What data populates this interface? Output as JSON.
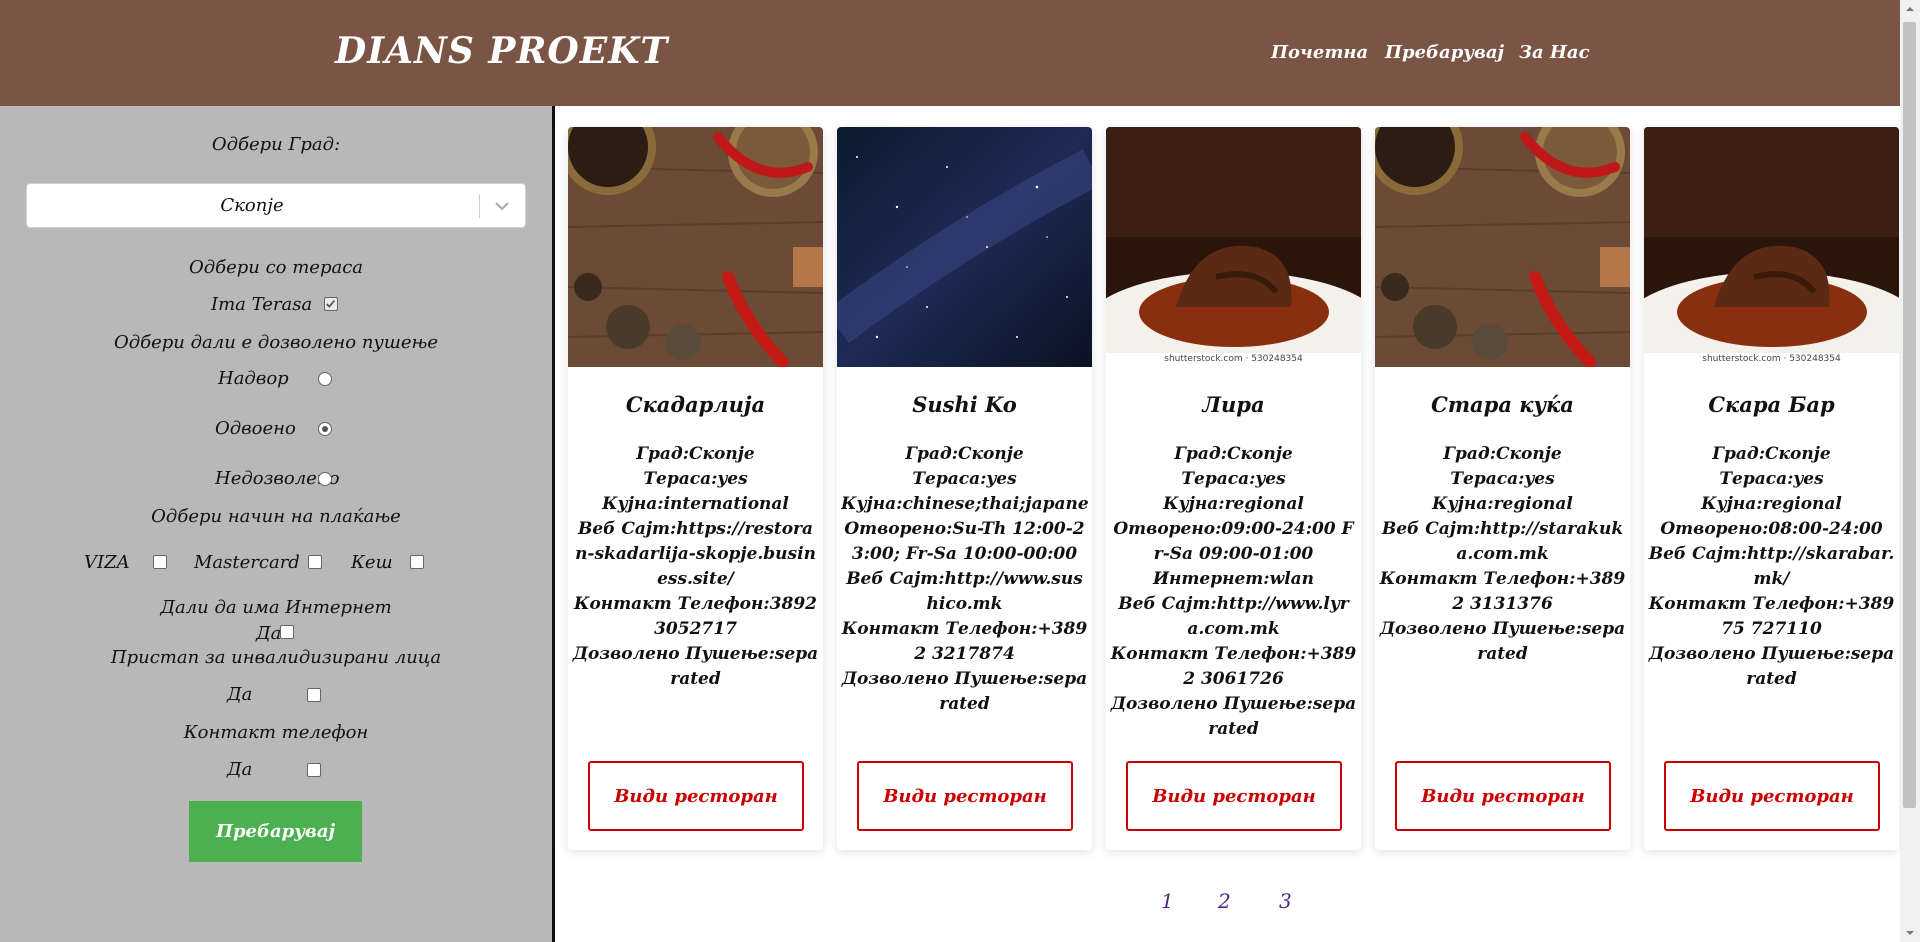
{
  "header": {
    "brand": "DIANS PROEKT",
    "nav": [
      "Почетна",
      "Пребарувај",
      "За Нас"
    ]
  },
  "filters": {
    "city_label": "Одбери Град:",
    "city_value": "Скопје",
    "terrace_label": "Одбери со тераса",
    "terrace_option": "Ima Terasa",
    "smoking_label": "Одбери дали е дозволено пушење",
    "smoking_options": [
      "Надвор",
      "Одвоено",
      "Недозволено"
    ],
    "payment_label": "Одбери начин на плаќање",
    "payment_options": [
      "VIZA",
      "Mastercard",
      "Кеш"
    ],
    "internet_label": "Дали да има Интернет",
    "internet_option": "Да",
    "accessibility_label": "Пристап за инвалидизирани лица",
    "accessibility_option": "Да",
    "phone_label": "Контакт телефон",
    "phone_option": "Да",
    "search_button": "Пребарувај"
  },
  "restaurants": [
    {
      "name": "Скадарлија",
      "info": [
        "Град:Скопје",
        "Тераса:yes",
        "Кујна:international",
        "Веб Сајт:https://restoran-skadarlija-skopje.business.site/",
        "Контакт Телефон:38923052717",
        "Дозволено Пушење:separated"
      ],
      "button": "Види ресторан"
    },
    {
      "name": "Sushi Ko",
      "info": [
        "Град:Скопје",
        "Тераса:yes",
        "Кујна:chinese;thai;japanese;sushi",
        "Отворено:Su-Th 12:00-23:00; Fr-Sa 10:00-00:00",
        "Веб Сајт:http://www.sushico.mk",
        "Контакт Телефон:+389 2 3217874",
        "Дозволено Пушење:separated"
      ],
      "button": "Види ресторан"
    },
    {
      "name": "Лира",
      "info": [
        "Град:Скопје",
        "Тераса:yes",
        "Кујна:regional",
        "Отворено:09:00-24:00 Fr-Sa 09:00-01:00",
        "Интернет:wlan",
        "Веб Сајт:http://www.lyra.com.mk",
        "Контакт Телефон:+389 2 3061726",
        "Дозволено Пушење:separated"
      ],
      "button": "Види ресторан",
      "caption": "shutterstock.com · 530248354"
    },
    {
      "name": "Стара куќа",
      "info": [
        "Град:Скопје",
        "Тераса:yes",
        "Кујна:regional",
        "Веб Сајт:http://starakuka.com.mk",
        "Контакт Телефон:+389 2 3131376",
        "Дозволено Пушење:separated"
      ],
      "button": "Види ресторан"
    },
    {
      "name": "Скара Бар",
      "info": [
        "Град:Скопје",
        "Тераса:yes",
        "Кујна:regional",
        "Отворено:08:00-24:00",
        "Веб Сајт:http://skarabar.mk/",
        "Контакт Телефон:+389 75 727110",
        "Дозволено Пушење:separated"
      ],
      "button": "Види ресторан",
      "caption": "shutterstock.com · 530248354"
    }
  ],
  "pagination": [
    "1",
    "2",
    "3"
  ],
  "colors": {
    "header_bg": "#7a5444",
    "sidebar_bg": "#b8b8b8",
    "search_button": "#4caf50",
    "card_button": "#cc0000",
    "page_link": "#4b2a8a"
  }
}
